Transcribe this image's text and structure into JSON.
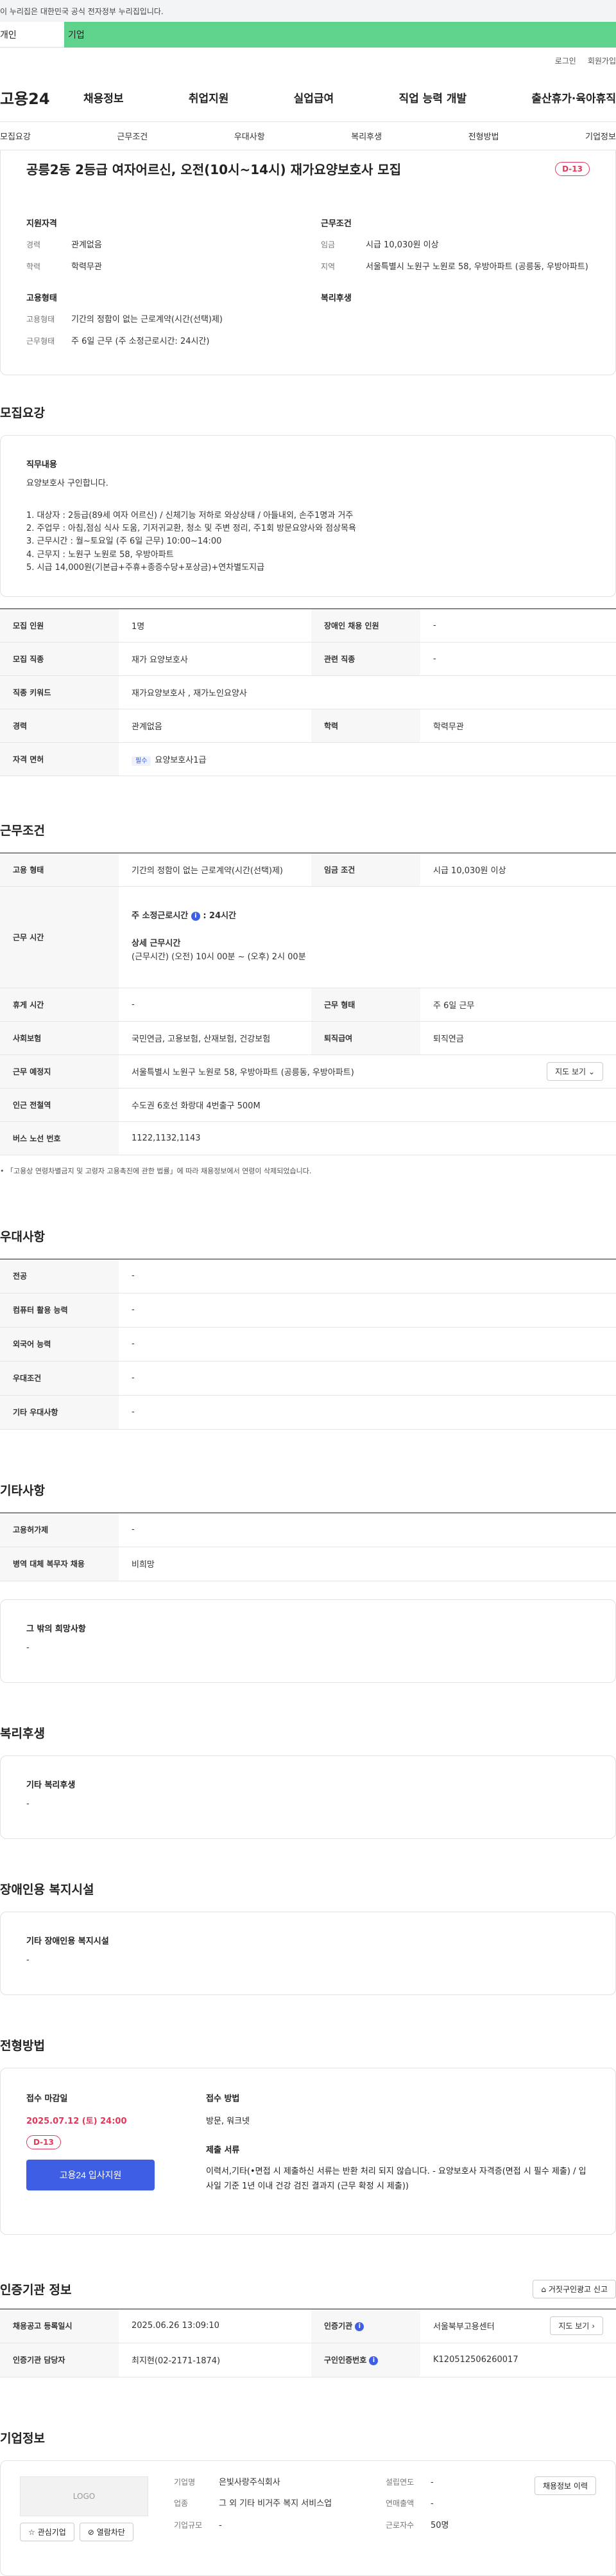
{
  "topbar": {
    "text": "이 누리집은 대한민국 공식 전자정부 누리집입니다."
  },
  "tabs": {
    "a": "개인",
    "b": "기업"
  },
  "util": {
    "login": "로그인",
    "join": "회원가입"
  },
  "gnb": {
    "logo": "고용24",
    "menu": [
      "채용정보",
      "취업지원",
      "실업급여",
      "직업 능력 개발",
      "출산휴가·육아휴직"
    ]
  },
  "subnav": [
    "모집요강",
    "근무조건",
    "우대사항",
    "복리후생",
    "전형방법",
    "기업정보"
  ],
  "head": {
    "title": "공릉2동 2등급 여자어르신, 오전(10시~14시) 재가요양보호사 모집",
    "dday": "D-13",
    "qual_title": "지원자격",
    "qual": [
      {
        "k": "경력",
        "v": "관계없음"
      },
      {
        "k": "학력",
        "v": "학력무관"
      }
    ],
    "work_title": "근무조건",
    "work": [
      {
        "k": "임금",
        "v": "시급 10,030원 이상"
      },
      {
        "k": "지역",
        "v": "서울특별시 노원구 노원로 58, 우방아파트 (공릉동, 우방아파트)"
      }
    ],
    "emp_title": "고용형태",
    "emp": [
      {
        "k": "고용형태",
        "v": "기간의 정함이 없는 근로계약(시간(선택)제)"
      },
      {
        "k": "근무형태",
        "v": "주 6일 근무 (주 소정근로시간: 24시간)"
      }
    ],
    "benefit_title": "복리후생"
  },
  "recruit": {
    "title": "모집요강",
    "job_title": "직무내용",
    "job_desc": "요양보호사 구인합니다.",
    "items": [
      "1. 대상자 : 2등급(89세 여자 어르신) / 신체기능 저하로 와상상태 / 아들내외, 손주1명과 거주",
      "2. 주업무 :  아침,점심 식사 도움, 기저귀교환, 청소 및 주변 정리, 주1회 방문요양사와 점상목욕",
      "3. 근무시간 : 월~토요일 (주 6일 근무)  10:00~14:00",
      "4. 근무지 : 노원구 노원로 58, 우방아파트",
      "5. 시급 14,000원(기본급+주휴+종증수당+포상금)+연차별도지급"
    ],
    "table": {
      "count_k": "모집 인원",
      "count_v": "1명",
      "disabled_k": "장애인 채용 인원",
      "disabled_v": "-",
      "job_k": "모집 직종",
      "job_v": "재가 요양보호사",
      "related_k": "관련 직종",
      "related_v": "-",
      "kw_k": "직종 키워드",
      "kw_v": "재가요양보호사 , 재가노인요양사",
      "career_k": "경력",
      "career_v": "관계없음",
      "edu_k": "학력",
      "edu_v": "학력무관",
      "license_k": "자격 면허",
      "license_tag": "필수",
      "license_v": "요양보호사1급"
    }
  },
  "work": {
    "title": "근무조건",
    "emp_k": "고용 형태",
    "emp_v": "기간의 정함이 없는 근로계약(시간(선택)제)",
    "wage_k": "임금 조건",
    "wage_v": "시급 10,030원 이상",
    "time_k": "근무 시간",
    "time_weekly": "주 소정근로시간",
    "time_weekly_v": ": 24시간",
    "time_detail_title": "상세 근무시간",
    "time_detail_v": "(근무시간) (오전) 10시 00분 ~ (오후) 2시 00분",
    "rest_k": "휴게 시간",
    "rest_v": "-",
    "type_k": "근무 형태",
    "type_v": "주 6일 근무",
    "ins_k": "사회보험",
    "ins_v": "국민연금, 고용보험, 산재보험, 건강보험",
    "pension_k": "퇴직급여",
    "pension_v": "퇴직연금",
    "place_k": "근무 예정지",
    "place_v": "서울특별시 노원구 노원로 58, 우방아파트 (공릉동, 우방아파트)",
    "map_btn": "지도 보기",
    "subway_k": "인근 전철역",
    "subway_v": "수도권 6호선 화랑대 4번출구 500M",
    "bus_k": "버스 노선 번호",
    "bus_v": "1122,1132,1143",
    "note": "「고용상 연령차별금지 및 고령자 고용촉진에 관한 법률」에 따라 채용정보에서 연령이 삭제되었습니다."
  },
  "pref": {
    "title": "우대사항",
    "rows": [
      {
        "k": "전공",
        "v": "-"
      },
      {
        "k": "컴퓨터 활용 능력",
        "v": "-"
      },
      {
        "k": "외국어 능력",
        "v": "-"
      },
      {
        "k": "우대조건",
        "v": "-"
      },
      {
        "k": "기타 우대사항",
        "v": "-"
      }
    ]
  },
  "etc": {
    "title": "기타사항",
    "rows": [
      {
        "k": "고용허가제",
        "v": "-"
      },
      {
        "k": "병역 대체 복무자 채용",
        "v": "비희망"
      }
    ],
    "other_title": "그 밖의 희망사항",
    "other_v": "-"
  },
  "welfare": {
    "title": "복리후생",
    "box_title": "기타 복리후생",
    "box_v": "-"
  },
  "disabled": {
    "title": "장애인용 복지시설",
    "box_title": "기타 장애인용 복지시설",
    "box_v": "-"
  },
  "apply": {
    "title": "전형방법",
    "deadline_title": "접수 마감일",
    "deadline_v": "2025.07.12 (토) 24:00",
    "dday": "D-13",
    "apply_btn": "고용24 입사지원",
    "method_title": "접수 방법",
    "method_v": "방문, 워크넷",
    "docs_title": "제출 서류",
    "docs_v": "이력서,기타(•면접 시 제출하신 서류는 반환 처리 되지 않습니다.  - 요양보호사 자격증(면접 시  필수 제출) / 입사일 기준 1년 이내 건강 검진 결과지 (근무 확정 시 제출))"
  },
  "cert": {
    "title": "인증기관 정보",
    "report_btn": "거짓구인광고 신고",
    "reg_k": "채용공고 등록일시",
    "reg_v": "2025.06.26 13:09:10",
    "org_k": "인증기관",
    "org_v": "서울북부고용센터",
    "map_btn": "지도 보기",
    "staff_k": "인증기관 담당자",
    "staff_v": "최지현(02-2171-1874)",
    "num_k": "구인인증번호",
    "num_v": "K120512506260017"
  },
  "company": {
    "title": "기업정보",
    "logo": "LOGO",
    "fav_btn": "관심기업",
    "block_btn": "열람차단",
    "name_k": "기업명",
    "name_v": "은빛사랑주식회사",
    "biz_k": "업종",
    "biz_v": "그 외 기타 비거주 복지 서비스업",
    "size_k": "기업규모",
    "size_v": "-",
    "year_k": "설립연도",
    "year_v": "-",
    "sales_k": "연매출액",
    "sales_v": "-",
    "emp_k": "근로자수",
    "emp_v": "50명",
    "jobs_btn": "채용정보 이력"
  },
  "colors": {
    "green": "#5fd38b",
    "accent": "#3e5fe3",
    "red": "#e3375b"
  }
}
